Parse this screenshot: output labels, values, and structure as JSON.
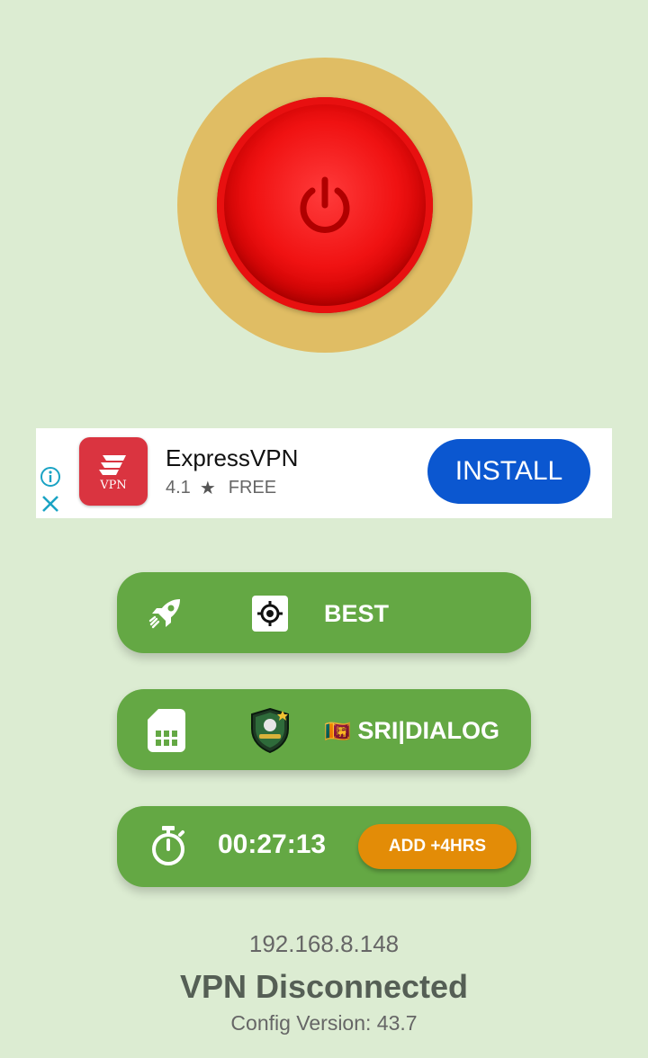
{
  "power_button": {
    "icon": "power-icon",
    "color": "#e81010",
    "ring_color": "#e0bd64"
  },
  "ad": {
    "app_name": "ExpressVPN",
    "logo_text": "VPN",
    "rating": "4.1",
    "price": "FREE",
    "install_label": "INSTALL",
    "icons": [
      "info-icon",
      "close-icon",
      "star-icon"
    ]
  },
  "server_mode": {
    "label": "BEST",
    "icons": [
      "rocket-icon",
      "target-icon"
    ]
  },
  "network": {
    "flag": "🇱🇰",
    "label": "SRI|DIALOG",
    "icons": [
      "sim-card-icon",
      "shield-badge-icon"
    ]
  },
  "timer": {
    "time": "00:27:13",
    "add_label": "ADD +4HRS",
    "icon": "stopwatch-icon"
  },
  "status": {
    "ip": "192.168.8.148",
    "connection": "VPN Disconnected",
    "config_version": "Config Version: 43.7"
  },
  "colors": {
    "background": "#dcecd2",
    "pill": "#64a844",
    "accent_orange": "#e38c07",
    "install_blue": "#0b57d0"
  }
}
